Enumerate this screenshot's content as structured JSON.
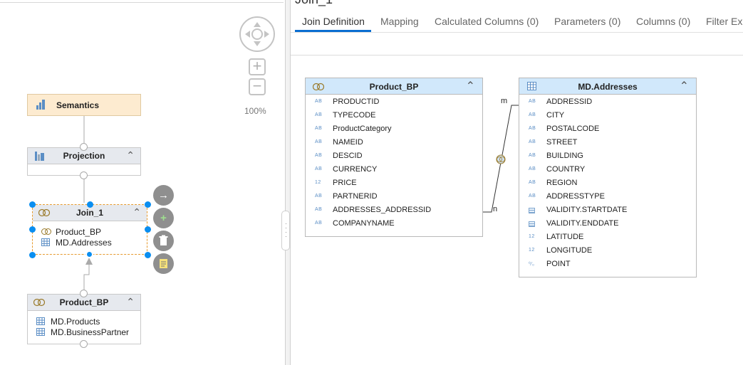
{
  "left": {
    "zoom_level": "100%",
    "nodes": {
      "semantics": {
        "title": "Semantics"
      },
      "projection": {
        "title": "Projection"
      },
      "join": {
        "title": "Join_1",
        "inputs": [
          "Product_BP",
          "MD.Addresses"
        ]
      },
      "product_bp": {
        "title": "Product_BP",
        "inputs": [
          "MD.Products",
          "MD.BusinessPartner"
        ]
      }
    },
    "actions": {
      "link": "→",
      "add": "+",
      "delete": "🗑",
      "note": "▤"
    }
  },
  "right": {
    "title": "Join_1",
    "tabs": [
      {
        "label": "Join Definition",
        "active": true
      },
      {
        "label": "Mapping"
      },
      {
        "label": "Calculated Columns (0)"
      },
      {
        "label": "Parameters (0)"
      },
      {
        "label": "Columns (0)"
      },
      {
        "label": "Filter Ex"
      }
    ],
    "left_table": {
      "title": "Product_BP",
      "fields": [
        {
          "type": "AB",
          "name": "PRODUCTID"
        },
        {
          "type": "AB",
          "name": "TYPECODE"
        },
        {
          "type": "AB",
          "name": "ProductCategory"
        },
        {
          "type": "AB",
          "name": "NAMEID"
        },
        {
          "type": "AB",
          "name": "DESCID"
        },
        {
          "type": "AB",
          "name": "CURRENCY"
        },
        {
          "type": "12",
          "name": "PRICE"
        },
        {
          "type": "AB",
          "name": "PARTNERID"
        },
        {
          "type": "AB",
          "name": "ADDRESSES_ADDRESSID"
        },
        {
          "type": "AB",
          "name": "COMPANYNAME"
        }
      ]
    },
    "right_table": {
      "title": "MD.Addresses",
      "fields": [
        {
          "type": "AB",
          "name": "ADDRESSID"
        },
        {
          "type": "AB",
          "name": "CITY"
        },
        {
          "type": "AB",
          "name": "POSTALCODE"
        },
        {
          "type": "AB",
          "name": "STREET"
        },
        {
          "type": "AB",
          "name": "BUILDING"
        },
        {
          "type": "AB",
          "name": "COUNTRY"
        },
        {
          "type": "AB",
          "name": "REGION"
        },
        {
          "type": "AB",
          "name": "ADDRESSTYPE"
        },
        {
          "type": "date",
          "name": "VALIDITY.STARTDATE"
        },
        {
          "type": "date",
          "name": "VALIDITY.ENDDATE"
        },
        {
          "type": "12",
          "name": "LATITUDE"
        },
        {
          "type": "12",
          "name": "LONGITUDE"
        },
        {
          "type": "geo",
          "name": "POINT"
        }
      ]
    },
    "join_labels": {
      "left_card": "n",
      "right_card": "m"
    }
  }
}
